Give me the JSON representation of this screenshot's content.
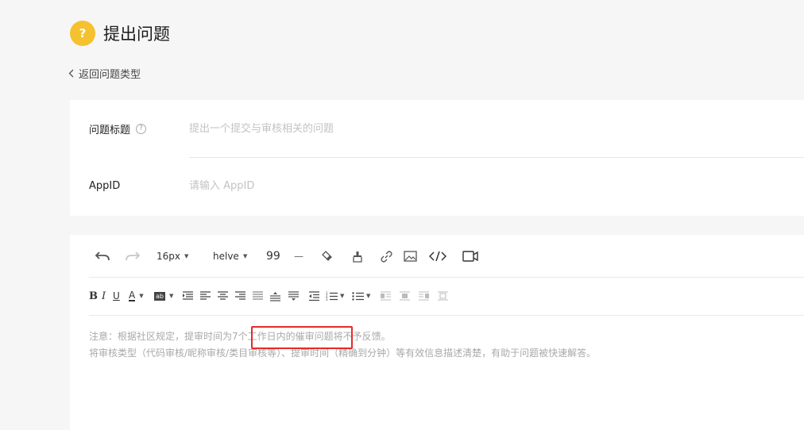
{
  "header": {
    "badge": "?",
    "title": "提出问题"
  },
  "back": {
    "label": "返回问题类型"
  },
  "form": {
    "title_row": {
      "label": "问题标题",
      "help": "?",
      "placeholder": "提出一个提交与审核相关的问题"
    },
    "appid_row": {
      "label": "AppID",
      "placeholder": "请输入 AppID"
    }
  },
  "toolbar": {
    "font_size": "16px",
    "font_family": "helvet",
    "quote": "99",
    "hr": "—"
  },
  "editor": {
    "line1": "注意：根据社区规定，提审时间为7个工作日内的催审问题将不予反馈。",
    "line2": "将审核类型（代码审核/昵称审核/类目审核等）、提审时间（精确到分钟）等有效信息描述清楚，有助于问题被快速解答。"
  },
  "colors": {
    "accent": "#f5c12e",
    "highlight": "#e52a2a"
  }
}
